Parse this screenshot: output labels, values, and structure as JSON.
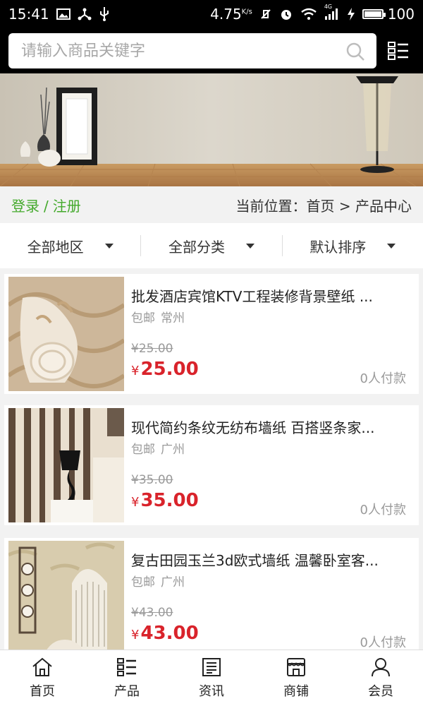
{
  "status_bar": {
    "time": "15:41",
    "network_speed": "4.75",
    "speed_unit": "K/s",
    "signal_label": "4G",
    "battery_level": "100"
  },
  "search": {
    "placeholder": "请输入商品关键字"
  },
  "location_bar": {
    "login": "登录",
    "separator": "/",
    "register": "注册",
    "breadcrumb": "当前位置：首页 > 产品中心"
  },
  "filters": [
    {
      "label": "全部地区"
    },
    {
      "label": "全部分类"
    },
    {
      "label": "默认排序"
    }
  ],
  "products": [
    {
      "title": "批发酒店宾馆KTV工程装修背景壁纸 ...",
      "shipping": "包邮",
      "city": "常州",
      "old_price": "¥25.00",
      "price_symbol": "¥",
      "price": "25.00",
      "buyers": "0人付款"
    },
    {
      "title": "现代简约条纹无纺布墙纸 百搭竖条家...",
      "shipping": "包邮",
      "city": "广州",
      "old_price": "¥35.00",
      "price_symbol": "¥",
      "price": "35.00",
      "buyers": "0人付款"
    },
    {
      "title": "复古田园玉兰3d欧式墙纸 温馨卧室客...",
      "shipping": "包邮",
      "city": "广州",
      "old_price": "¥43.00",
      "price_symbol": "¥",
      "price": "43.00",
      "buyers": "0人付款"
    }
  ],
  "bottom_nav": [
    {
      "label": "首页",
      "icon": "home-icon"
    },
    {
      "label": "产品",
      "icon": "list-icon"
    },
    {
      "label": "资讯",
      "icon": "news-icon"
    },
    {
      "label": "商铺",
      "icon": "shop-icon"
    },
    {
      "label": "会员",
      "icon": "user-icon"
    }
  ],
  "colors": {
    "accent_green": "#43a92b",
    "price_red": "#d9232b",
    "header_black": "#000000"
  }
}
